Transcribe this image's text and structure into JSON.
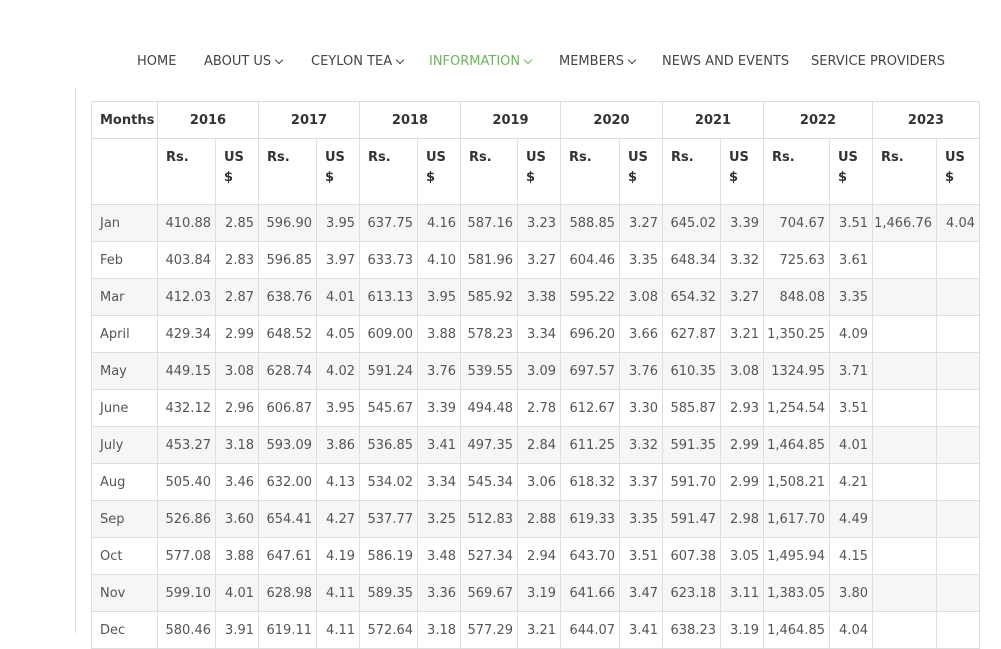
{
  "nav": {
    "items": [
      {
        "label": "HOME",
        "dropdown": false,
        "active": false
      },
      {
        "label": "ABOUT US",
        "dropdown": true,
        "active": false
      },
      {
        "label": "CEYLON TEA",
        "dropdown": true,
        "active": false
      },
      {
        "label": "INFORMATION",
        "dropdown": true,
        "active": true
      },
      {
        "label": "MEMBERS",
        "dropdown": true,
        "active": false
      },
      {
        "label": "NEWS AND EVENTS",
        "dropdown": false,
        "active": false
      },
      {
        "label": "SERVICE PROVIDERS",
        "dropdown": false,
        "active": false
      }
    ],
    "active_color": "#6cb35a"
  },
  "table": {
    "months_header": "Months",
    "years": [
      "2016",
      "2017",
      "2018",
      "2019",
      "2020",
      "2021",
      "2022",
      "2023"
    ],
    "currency_rs": "Rs.",
    "currency_usd": "US $",
    "rows": [
      {
        "month": "Jan",
        "values": [
          "410.88",
          "2.85",
          "596.90",
          "3.95",
          "637.75",
          "4.16",
          "587.16",
          "3.23",
          "588.85",
          "3.27",
          "645.02",
          "3.39",
          "704.67",
          "3.51",
          "1,466.76",
          "4.04"
        ]
      },
      {
        "month": "Feb",
        "values": [
          "403.84",
          "2.83",
          "596.85",
          "3.97",
          "633.73",
          "4.10",
          "581.96",
          "3.27",
          "604.46",
          "3.35",
          "648.34",
          "3.32",
          "725.63",
          "3.61",
          "",
          ""
        ]
      },
      {
        "month": "Mar",
        "values": [
          "412.03",
          "2.87",
          "638.76",
          "4.01",
          "613.13",
          "3.95",
          "585.92",
          "3.38",
          "595.22",
          "3.08",
          "654.32",
          "3.27",
          "848.08",
          "3.35",
          "",
          ""
        ]
      },
      {
        "month": "April",
        "values": [
          "429.34",
          "2.99",
          "648.52",
          "4.05",
          "609.00",
          "3.88",
          "578.23",
          "3.34",
          "696.20",
          "3.66",
          "627.87",
          "3.21",
          "1,350.25",
          "4.09",
          "",
          ""
        ]
      },
      {
        "month": "May",
        "values": [
          "449.15",
          "3.08",
          "628.74",
          "4.02",
          "591.24",
          "3.76",
          "539.55",
          "3.09",
          "697.57",
          "3.76",
          "610.35",
          "3.08",
          "1324.95",
          "3.71",
          "",
          ""
        ]
      },
      {
        "month": "June",
        "values": [
          "432.12",
          "2.96",
          "606.87",
          "3.95",
          "545.67",
          "3.39",
          "494.48",
          "2.78",
          "612.67",
          "3.30",
          "585.87",
          "2.93",
          "1,254.54",
          "3.51",
          "",
          ""
        ]
      },
      {
        "month": "July",
        "values": [
          "453.27",
          "3.18",
          "593.09",
          "3.86",
          "536.85",
          "3.41",
          "497.35",
          "2.84",
          "611.25",
          "3.32",
          "591.35",
          "2.99",
          "1,464.85",
          "4.01",
          "",
          ""
        ]
      },
      {
        "month": "Aug",
        "values": [
          "505.40",
          "3.46",
          "632.00",
          "4.13",
          "534.02",
          "3.34",
          "545.34",
          "3.06",
          "618.32",
          "3.37",
          "591.70",
          "2.99",
          "1,508.21",
          "4.21",
          "",
          ""
        ]
      },
      {
        "month": "Sep",
        "values": [
          "526.86",
          "3.60",
          "654.41",
          "4.27",
          "537.77",
          "3.25",
          "512.83",
          "2.88",
          "619.33",
          "3.35",
          "591.47",
          "2.98",
          "1,617.70",
          "4.49",
          "",
          ""
        ]
      },
      {
        "month": "Oct",
        "values": [
          "577.08",
          "3.88",
          "647.61",
          "4.19",
          "586.19",
          "3.48",
          "527.34",
          "2.94",
          "643.70",
          "3.51",
          "607.38",
          "3.05",
          "1,495.94",
          "4.15",
          "",
          ""
        ]
      },
      {
        "month": "Nov",
        "values": [
          "599.10",
          "4.01",
          "628.98",
          "4.11",
          "589.35",
          "3.36",
          "569.67",
          "3.19",
          "641.66",
          "3.47",
          "623.18",
          "3.11",
          "1,383.05",
          "3.80",
          "",
          ""
        ]
      },
      {
        "month": "Dec",
        "values": [
          "580.46",
          "3.91",
          "619.11",
          "4.11",
          "572.64",
          "3.18",
          "577.29",
          "3.21",
          "644.07",
          "3.41",
          "638.23",
          "3.19",
          "1,464.85",
          "4.04",
          "",
          ""
        ]
      }
    ]
  }
}
